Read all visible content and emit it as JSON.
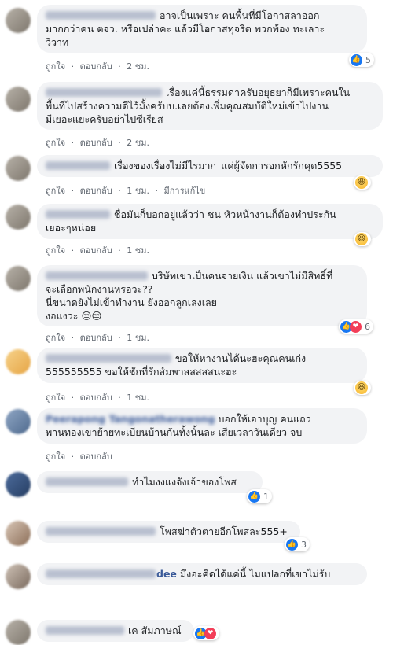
{
  "comments": [
    {
      "author": "",
      "lines": [
        "อาจเป็นเพราะ คนพื้นที่มีโอกาสลาออก",
        "มากกว่าคน ตจว. หรือเปล่าคะ แล้วมีโอกาสทุจริต พวกพ้อง ทะเลาะ",
        "วิวาท"
      ],
      "like": "ถูกใจ",
      "reply": "ตอบกลับ",
      "time": "2 ชม.",
      "edited": "",
      "reaction_count": "5"
    },
    {
      "author": "",
      "lines": [
        "เรื่องแค่นี้ธรรมดาครับอยุธยาก็มีเพราะคนใน",
        "พื้นที่ไปสร้างความดีไว้มั้งครับบ.เลยต้องเพิ่มคุณสมบัติใหม่เข้าไปงาน",
        "มีเยอะแยะครับอย่าไปซีเรียส"
      ],
      "like": "ถูกใจ",
      "reply": "ตอบกลับ",
      "time": "2 ชม.",
      "edited": "",
      "reaction_count": ""
    },
    {
      "author": "",
      "lines": [
        "เรื่องของเรื่องไม่มีไรมาก_แค่ผู้จัดการอกหักรักคุด5555"
      ],
      "like": "ถูกใจ",
      "reply": "ตอบกลับ",
      "time": "1 ชม.",
      "edited": "มีการแก้ไข",
      "reaction_count": ""
    },
    {
      "author": "",
      "lines": [
        "ชื่อมันก็บอกอยู่แล้วว่า ชน หัวหน้างานก็ต้องทำประกัน",
        "เยอะๆหน่อย"
      ],
      "like": "ถูกใจ",
      "reply": "ตอบกลับ",
      "time": "1 ชม.",
      "edited": "",
      "reaction_count": ""
    },
    {
      "author": "",
      "lines": [
        "บริษัทเขาเป็นคนจ่ายเงิน แล้วเขาไม่มีสิทธิ์ที่",
        "จะเลือกพนักงานหรอวะ??",
        "นี่ขนาดยังไม่เข้าทำงาน ยังออกลูกเลงเลย",
        "งอแงวะ 😒😒"
      ],
      "like": "ถูกใจ",
      "reply": "ตอบกลับ",
      "time": "1 ชม.",
      "edited": "",
      "reaction_count": "6"
    },
    {
      "author": "",
      "lines": [
        "ขอให้หางานได้นะฮะคุณคนเก่ง",
        "555555555 ขอให้ชักที่รักส์มพาสสสสสนะฮะ"
      ],
      "like": "ถูกใจ",
      "reply": "ตอบกลับ",
      "time": "1 ชม.",
      "edited": "",
      "reaction_count": ""
    },
    {
      "author": "Peerapong Tangonatherawong",
      "lines": [
        "บอกให้เอาบุญ คนแถว",
        "พานทองเขาย้ายทะเบียนบ้านกันทั้งนั้นละ เสียเวลาวันเดียว จบ"
      ],
      "like": "ถูกใจ",
      "reply": "ตอบกลับ",
      "time": "",
      "edited": "",
      "reaction_count": ""
    },
    {
      "author": "",
      "lines": [
        "ทำไมงงแงจังเจ้าของโพส"
      ],
      "like": "",
      "reply": "",
      "time": "",
      "edited": "",
      "reaction_count": "1"
    },
    {
      "author": "",
      "lines": [
        "โพสฆ่าตัวตายอีกโพสละ555+"
      ],
      "like": "",
      "reply": "",
      "time": "",
      "edited": "",
      "reaction_count": "3"
    },
    {
      "author": "dee",
      "lines": [
        "มึงอะคิดได้แค่นี้ ไมแปลกที่เขาไม่รับ"
      ],
      "like": "",
      "reply": "",
      "time": "",
      "edited": "",
      "reaction_count": ""
    },
    {
      "author": "",
      "lines": [
        "เค สัมภาษณ์"
      ],
      "like": "",
      "reply": "",
      "time": "",
      "edited": "",
      "reaction_count": ""
    }
  ],
  "separator": "·",
  "colors": {
    "link": "#385898",
    "bubble": "#f2f3f5",
    "like": "#1877f2",
    "love": "#f33e58"
  }
}
